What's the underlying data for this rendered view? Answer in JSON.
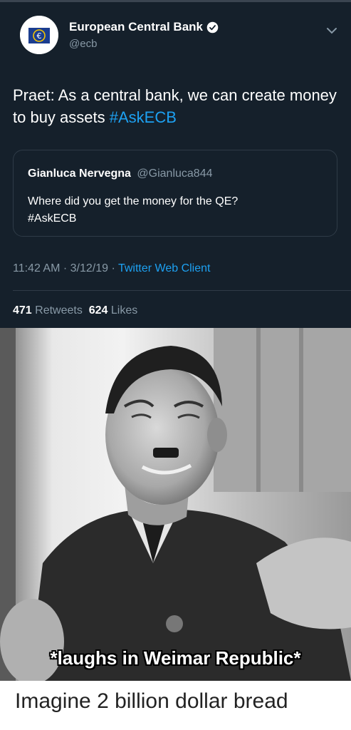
{
  "account": {
    "name": "European Central Bank",
    "handle": "@ecb"
  },
  "tweet": {
    "text": "Praet: As a central bank, we can create money to buy assets ",
    "hashtag": "#AskECB"
  },
  "quoted": {
    "name": "Gianluca Nervegna",
    "handle": "@Gianluca844",
    "text": "Where did you get the money for the QE?",
    "hashtag": "#AskECB"
  },
  "meta": {
    "time": "11:42 AM · 3/12/19 · ",
    "client": "Twitter Web Client"
  },
  "stats": {
    "retweets_count": "471",
    "retweets_label": " Retweets  ",
    "likes_count": "624",
    "likes_label": " Likes"
  },
  "photo": {
    "caption": "*laughs in Weimar Republic*"
  },
  "footer": {
    "text": "Imagine 2 billion dollar bread"
  },
  "icons": {
    "avatar": "ecb-logo-icon",
    "verified": "verified-badge-icon",
    "menu": "chevron-down-icon"
  },
  "colors": {
    "background": "#15202b",
    "accent": "#1da1f2",
    "secondary_text": "#8899a6"
  }
}
